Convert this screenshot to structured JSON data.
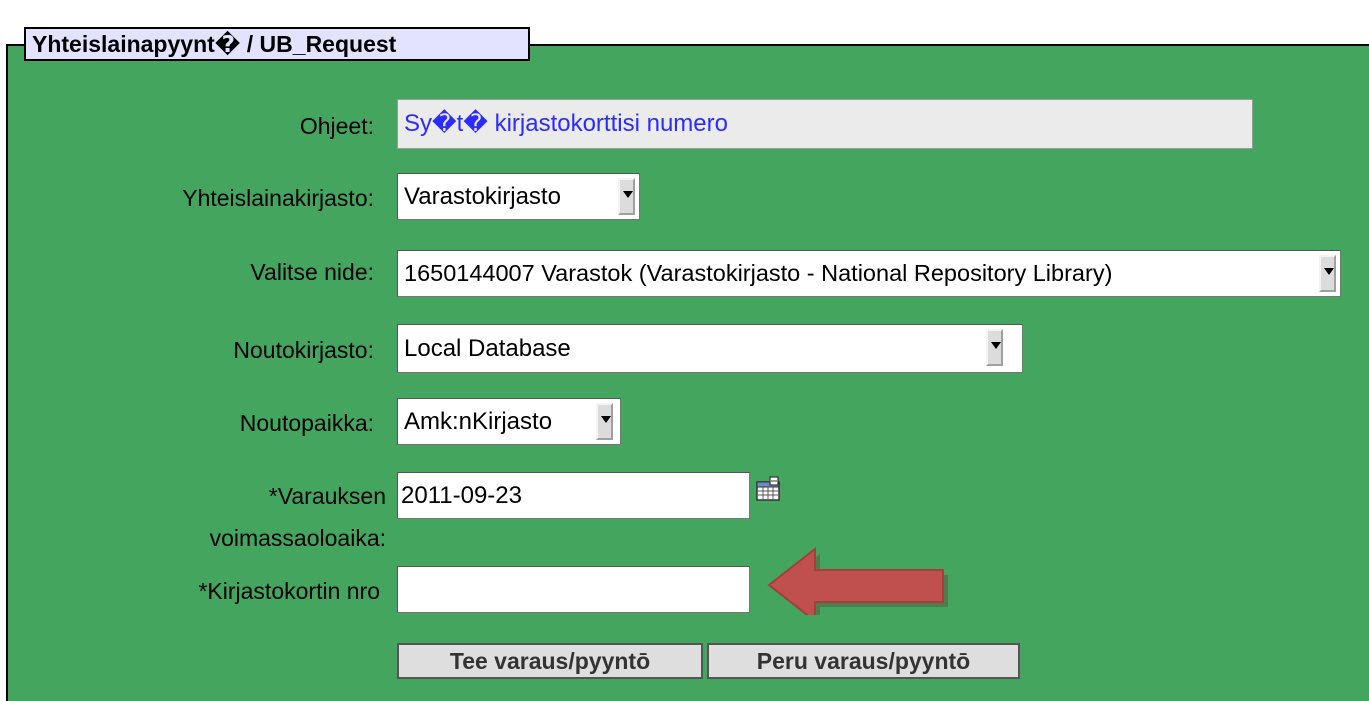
{
  "legend": {
    "title": "Yhteislainapyynt� / UB_Request"
  },
  "form": {
    "instructions": {
      "label": "Ohjeet:",
      "value": "Sy�t� kirjastokorttisi numero"
    },
    "ub_library": {
      "label": "Yhteislainakirjasto:",
      "selected": "Varastokirjasto"
    },
    "item": {
      "label": "Valitse nide:",
      "selected": "1650144007 Varastok (Varastokirjasto - National Repository Library)"
    },
    "pickup_library": {
      "label": "Noutokirjasto:",
      "selected": "Local Database"
    },
    "pickup_location": {
      "label": "Noutopaikka:",
      "selected": "Amk:nKirjasto"
    },
    "expiry": {
      "label_line1": "*Varauksen",
      "label_line2": "voimassaoloaika:",
      "value": "2011-09-23",
      "icon": "calendar-icon"
    },
    "card_number": {
      "label": "*Kirjastokortin nro",
      "value": ""
    }
  },
  "buttons": {
    "submit": "Tee varaus/pyyntō",
    "cancel": "Peru varaus/pyyntō"
  },
  "annotation": {
    "arrow_color": "#c0504d",
    "icon": "left-arrow"
  }
}
